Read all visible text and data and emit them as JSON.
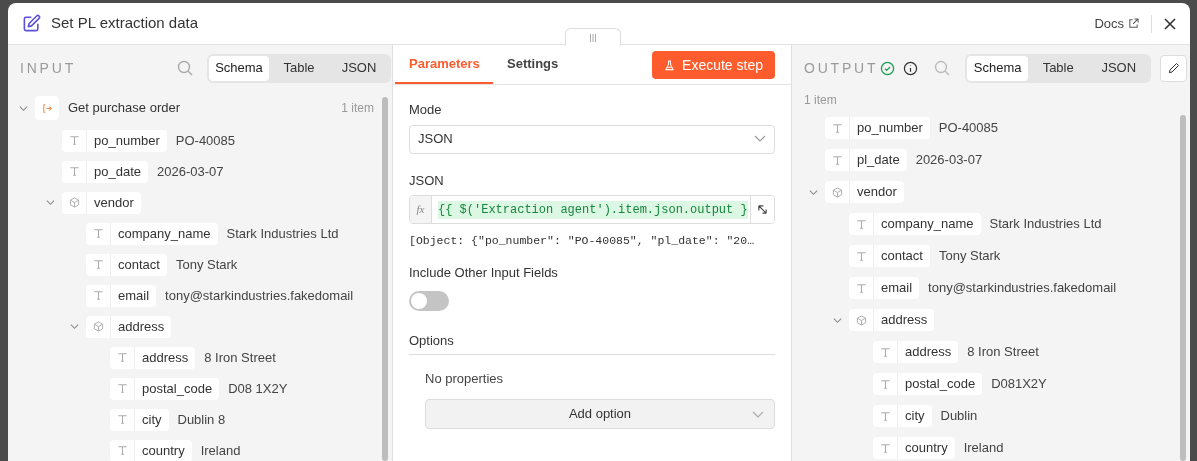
{
  "dialog": {
    "title": "Set PL extraction data",
    "docs_link": "Docs"
  },
  "input": {
    "label": "INPUT",
    "view_tabs": [
      {
        "label": "Schema",
        "selected": true
      },
      {
        "label": "Table",
        "selected": false
      },
      {
        "label": "JSON",
        "selected": false
      }
    ],
    "source": {
      "name": "Get purchase order",
      "count": "1 item",
      "expanded": true
    },
    "fields": [
      {
        "kind": "string",
        "name": "po_number",
        "value": "PO-40085"
      },
      {
        "kind": "string",
        "name": "po_date",
        "value": "2026-03-07"
      },
      {
        "kind": "object",
        "name": "vendor",
        "expanded": true,
        "children": [
          {
            "kind": "string",
            "name": "company_name",
            "value": "Stark Industries Ltd"
          },
          {
            "kind": "string",
            "name": "contact",
            "value": "Tony Stark"
          },
          {
            "kind": "string",
            "name": "email",
            "value": "tony@starkindustries.fakedomail"
          },
          {
            "kind": "object",
            "name": "address",
            "expanded": true,
            "children": [
              {
                "kind": "string",
                "name": "address",
                "value": "8 Iron Street"
              },
              {
                "kind": "string",
                "name": "postal_code",
                "value": "D08 1X2Y"
              },
              {
                "kind": "string",
                "name": "city",
                "value": "Dublin 8"
              },
              {
                "kind": "string",
                "name": "country",
                "value": "Ireland"
              }
            ]
          }
        ]
      }
    ]
  },
  "parameters": {
    "tabs": [
      {
        "label": "Parameters",
        "selected": true
      },
      {
        "label": "Settings",
        "selected": false
      }
    ],
    "execute_button": "Execute step",
    "mode": {
      "label": "Mode",
      "value": "JSON"
    },
    "json": {
      "label": "JSON",
      "fx_label": "fx",
      "expression": "{{ $('Extraction agent').item.json.output }",
      "preview": "[Object: {\"po_number\": \"PO-40085\", \"pl_date\": \"20…"
    },
    "include_other": {
      "label": "Include Other Input Fields",
      "on": false
    },
    "options": {
      "label": "Options",
      "empty_text": "No properties",
      "add_button": "Add option"
    }
  },
  "output": {
    "label": "OUTPUT",
    "success": true,
    "view_tabs": [
      {
        "label": "Schema",
        "selected": true
      },
      {
        "label": "Table",
        "selected": false
      },
      {
        "label": "JSON",
        "selected": false
      }
    ],
    "count": "1 item",
    "fields": [
      {
        "kind": "string",
        "name": "po_number",
        "value": "PO-40085"
      },
      {
        "kind": "string",
        "name": "pl_date",
        "value": "2026-03-07"
      },
      {
        "kind": "object",
        "name": "vendor",
        "expanded": true,
        "children": [
          {
            "kind": "string",
            "name": "company_name",
            "value": "Stark Industries Ltd"
          },
          {
            "kind": "string",
            "name": "contact",
            "value": "Tony Stark"
          },
          {
            "kind": "string",
            "name": "email",
            "value": "tony@starkindustries.fakedomail"
          },
          {
            "kind": "object",
            "name": "address",
            "expanded": true,
            "children": [
              {
                "kind": "string",
                "name": "address",
                "value": "8 Iron Street"
              },
              {
                "kind": "string",
                "name": "postal_code",
                "value": "D081X2Y"
              },
              {
                "kind": "string",
                "name": "city",
                "value": "Dublin"
              },
              {
                "kind": "string",
                "name": "country",
                "value": "Ireland"
              }
            ]
          }
        ]
      }
    ]
  }
}
